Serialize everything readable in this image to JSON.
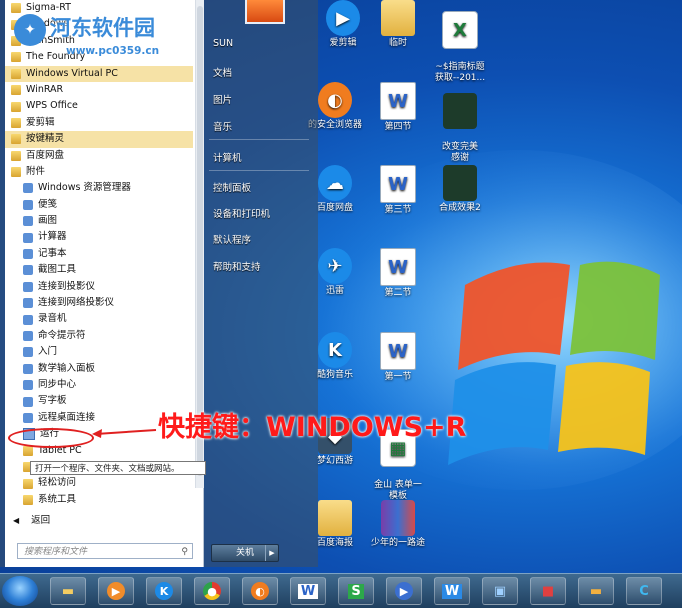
{
  "watermark": {
    "title": "河东软件园",
    "url": "www.pc0359.cn"
  },
  "start_menu": {
    "programs": [
      {
        "label": "Sigma-RT",
        "icon": "folder",
        "sub": false,
        "highlight": false
      },
      {
        "label": "Windows",
        "icon": "folder",
        "sub": false,
        "highlight": false
      },
      {
        "label": "TechSmith",
        "icon": "folder",
        "sub": false,
        "highlight": false
      },
      {
        "label": "The Foundry",
        "icon": "folder",
        "sub": false,
        "highlight": false
      },
      {
        "label": "Windows Virtual PC",
        "icon": "folder",
        "sub": false,
        "highlight": true
      },
      {
        "label": "WinRAR",
        "icon": "folder",
        "sub": false,
        "highlight": false
      },
      {
        "label": "WPS Office",
        "icon": "folder",
        "sub": false,
        "highlight": false
      },
      {
        "label": "爱剪辑",
        "icon": "folder",
        "sub": false,
        "highlight": false
      },
      {
        "label": "按键精灵",
        "icon": "folder",
        "sub": false,
        "highlight": true
      },
      {
        "label": "百度网盘",
        "icon": "folder",
        "sub": false,
        "highlight": false
      },
      {
        "label": "附件",
        "icon": "folder",
        "sub": false,
        "highlight": false
      },
      {
        "label": "Windows 资源管理器",
        "icon": "app",
        "sub": true,
        "highlight": false
      },
      {
        "label": "便笺",
        "icon": "app",
        "sub": true,
        "highlight": false
      },
      {
        "label": "画图",
        "icon": "app",
        "sub": true,
        "highlight": false
      },
      {
        "label": "计算器",
        "icon": "app",
        "sub": true,
        "highlight": false
      },
      {
        "label": "记事本",
        "icon": "app",
        "sub": true,
        "highlight": false
      },
      {
        "label": "截图工具",
        "icon": "app",
        "sub": true,
        "highlight": false
      },
      {
        "label": "连接到投影仪",
        "icon": "app",
        "sub": true,
        "highlight": false
      },
      {
        "label": "连接到网络投影仪",
        "icon": "app",
        "sub": true,
        "highlight": false
      },
      {
        "label": "录音机",
        "icon": "app",
        "sub": true,
        "highlight": false
      },
      {
        "label": "命令提示符",
        "icon": "app",
        "sub": true,
        "highlight": false
      },
      {
        "label": "入门",
        "icon": "app",
        "sub": true,
        "highlight": false
      },
      {
        "label": "数学输入面板",
        "icon": "app",
        "sub": true,
        "highlight": false
      },
      {
        "label": "同步中心",
        "icon": "app",
        "sub": true,
        "highlight": false
      },
      {
        "label": "写字板",
        "icon": "app",
        "sub": true,
        "highlight": false
      },
      {
        "label": "远程桌面连接",
        "icon": "app",
        "sub": true,
        "highlight": false
      },
      {
        "label": "运行",
        "icon": "run",
        "sub": true,
        "highlight": false
      },
      {
        "label": "Tablet PC",
        "icon": "folder",
        "sub": true,
        "highlight": false
      },
      {
        "label": "",
        "icon": "folder",
        "sub": true,
        "highlight": false
      },
      {
        "label": "轻松访问",
        "icon": "folder",
        "sub": true,
        "highlight": false
      },
      {
        "label": "系统工具",
        "icon": "folder",
        "sub": true,
        "highlight": false
      }
    ],
    "back_label": "返回",
    "search_placeholder": "搜索程序和文件",
    "tooltip": "打开一个程序、文件夹、文档或网站。",
    "right_items": [
      "SUN",
      "文档",
      "图片",
      "音乐",
      "计算机",
      "控制面板",
      "设备和打印机",
      "默认程序",
      "帮助和支持"
    ],
    "shutdown_label": "关机"
  },
  "annotation": "快捷键：WINDOWS+R",
  "desktop_icons": [
    {
      "label": "爱剪辑",
      "kind": "blue"
    },
    {
      "label": "临时",
      "kind": "folder"
    },
    {
      "label": "~$指南标题\n获取--201...",
      "kind": "xls"
    },
    {
      "label": "的安全浏览器",
      "kind": "orange"
    },
    {
      "label": "第四节",
      "kind": "doc"
    },
    {
      "label": "改变完美\n感谢",
      "kind": "img"
    },
    {
      "label": "百度网盘",
      "kind": "blue"
    },
    {
      "label": "第三节",
      "kind": "doc"
    },
    {
      "label": "合成效果2",
      "kind": "img"
    },
    {
      "label": "迅雷",
      "kind": "blue"
    },
    {
      "label": "第二节",
      "kind": "doc"
    },
    {
      "label": "酷狗音乐",
      "kind": "blue"
    },
    {
      "label": "第一节",
      "kind": "doc"
    },
    {
      "label": "梦幻西游",
      "kind": "dark"
    },
    {
      "label": "金山 表单一\n模板",
      "kind": "xls"
    },
    {
      "label": "百度海报",
      "kind": "folder"
    },
    {
      "label": "少年的一路途",
      "kind": "rar"
    }
  ],
  "taskbar": [
    "start",
    "explorer",
    "media",
    "kugou",
    "chrome",
    "uc",
    "wps-writer",
    "wps-sheet",
    "aijianji",
    "word",
    "media2",
    "toolbox",
    "folder",
    "c"
  ]
}
